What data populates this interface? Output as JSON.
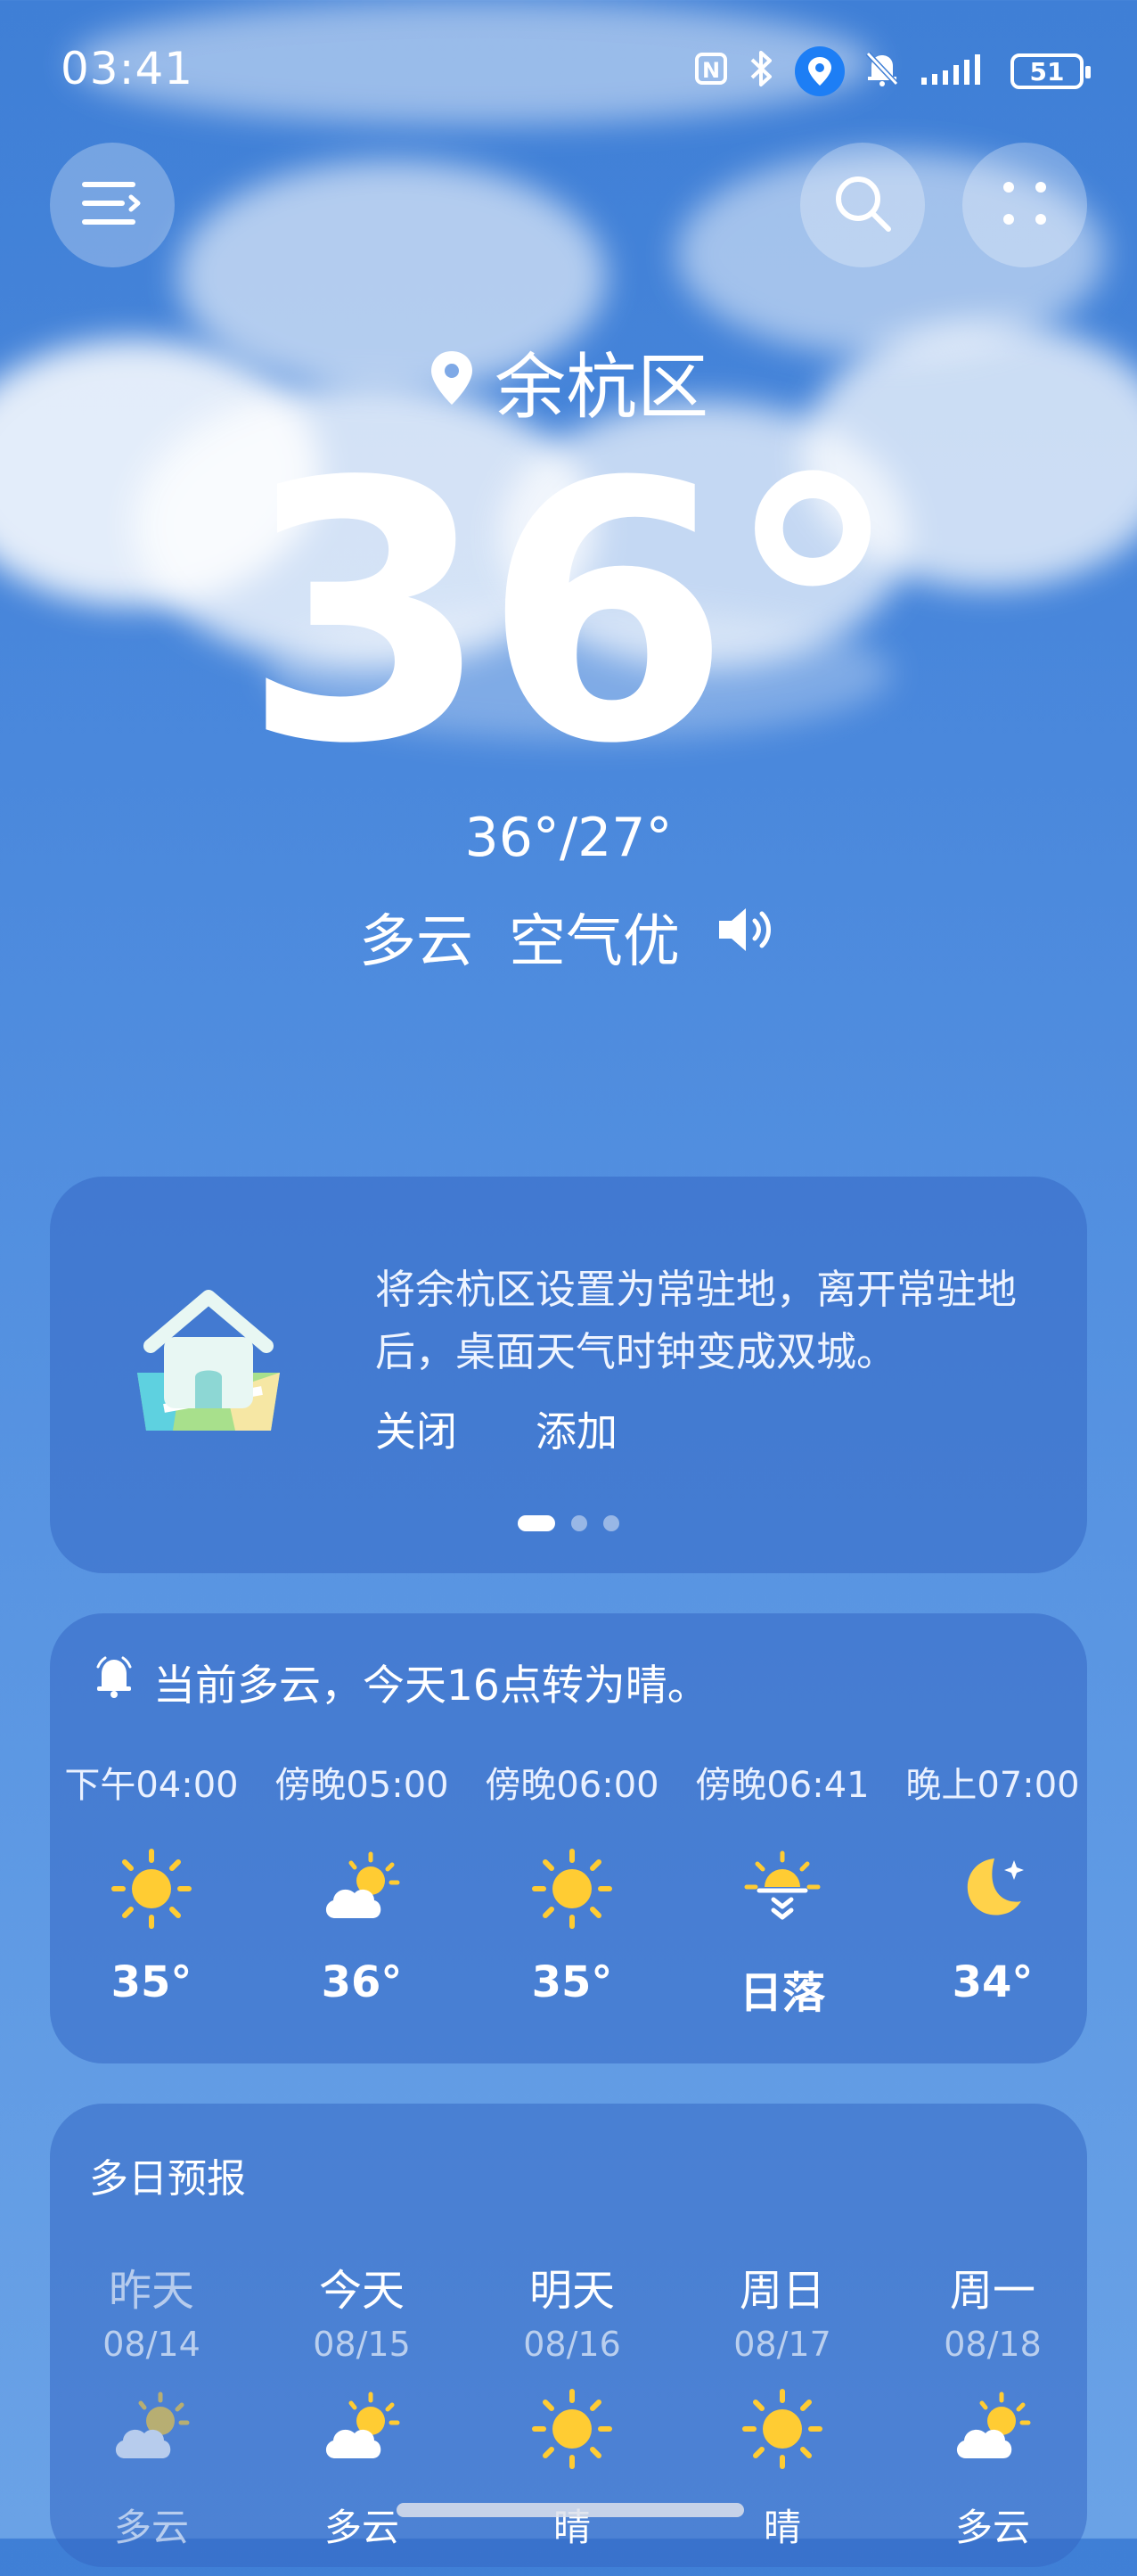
{
  "status_bar": {
    "time": "03:41",
    "icons": [
      "nfc-icon",
      "bluetooth-icon",
      "location-icon",
      "mute-icon",
      "signal-icon"
    ],
    "battery": "51"
  },
  "header": {
    "menu_icon": "menu-icon",
    "search_icon": "search-icon",
    "more_icon": "more-icon"
  },
  "current": {
    "city": "余杭区",
    "temperature": "36°",
    "high_low": "36°/27°",
    "condition": "多云",
    "air_quality": "空气优"
  },
  "tip_card": {
    "text": "将余杭区设置为常驻地，离开常驻地后，桌面天气时钟变成双城。",
    "close_label": "关闭",
    "add_label": "添加",
    "page_count": 3,
    "active_page": 1
  },
  "hourly_card": {
    "alert": "当前多云，今天16点转为晴。",
    "hours": [
      {
        "label": "下午04:00",
        "icon": "sun-icon",
        "value": "35°"
      },
      {
        "label": "傍晚05:00",
        "icon": "partly-cloudy-icon",
        "value": "36°"
      },
      {
        "label": "傍晚06:00",
        "icon": "sun-icon",
        "value": "35°"
      },
      {
        "label": "傍晚06:41",
        "icon": "sunset-icon",
        "value": "日落"
      },
      {
        "label": "晚上07:00",
        "icon": "moon-icon",
        "value": "34°"
      }
    ]
  },
  "daily_card": {
    "title": "多日预报",
    "days": [
      {
        "name": "昨天",
        "date": "08/14",
        "icon": "partly-cloudy-icon",
        "condition": "多云"
      },
      {
        "name": "今天",
        "date": "08/15",
        "icon": "partly-cloudy-icon",
        "condition": "多云"
      },
      {
        "name": "明天",
        "date": "08/16",
        "icon": "sun-icon",
        "condition": "晴"
      },
      {
        "name": "周日",
        "date": "08/17",
        "icon": "sun-icon",
        "condition": "晴"
      },
      {
        "name": "周一",
        "date": "08/18",
        "icon": "partly-cloudy-icon",
        "condition": "多云"
      }
    ]
  },
  "colors": {
    "sky_top": "#3f7fd6",
    "card_bg": "#3567c4",
    "sun": "#ffcc33",
    "location_bubble": "#1d7ef5"
  }
}
